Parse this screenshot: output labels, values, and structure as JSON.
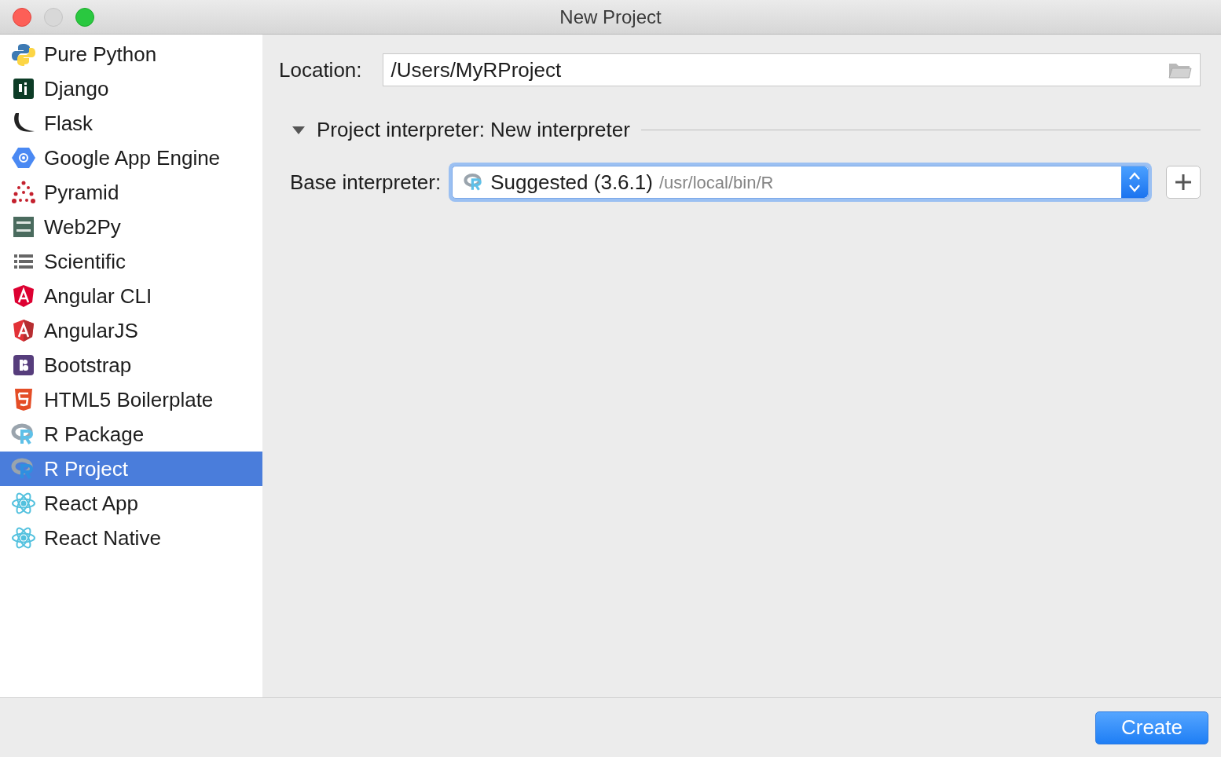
{
  "window": {
    "title": "New Project"
  },
  "sidebar": {
    "items": [
      {
        "label": "Pure Python",
        "selected": false
      },
      {
        "label": "Django",
        "selected": false
      },
      {
        "label": "Flask",
        "selected": false
      },
      {
        "label": "Google App Engine",
        "selected": false
      },
      {
        "label": "Pyramid",
        "selected": false
      },
      {
        "label": "Web2Py",
        "selected": false
      },
      {
        "label": "Scientific",
        "selected": false
      },
      {
        "label": "Angular CLI",
        "selected": false
      },
      {
        "label": "AngularJS",
        "selected": false
      },
      {
        "label": "Bootstrap",
        "selected": false
      },
      {
        "label": "HTML5 Boilerplate",
        "selected": false
      },
      {
        "label": "R Package",
        "selected": false
      },
      {
        "label": "R Project",
        "selected": true
      },
      {
        "label": "React App",
        "selected": false
      },
      {
        "label": "React Native",
        "selected": false
      }
    ]
  },
  "location": {
    "label": "Location:",
    "value": "/Users/MyRProject"
  },
  "interpreter_section": {
    "title": "Project interpreter: New interpreter",
    "expanded": true
  },
  "base_interpreter": {
    "label": "Base interpreter:",
    "value": "Suggested (3.6.1)",
    "path": "/usr/local/bin/R"
  },
  "buttons": [
    {
      "label": "Create"
    }
  ]
}
